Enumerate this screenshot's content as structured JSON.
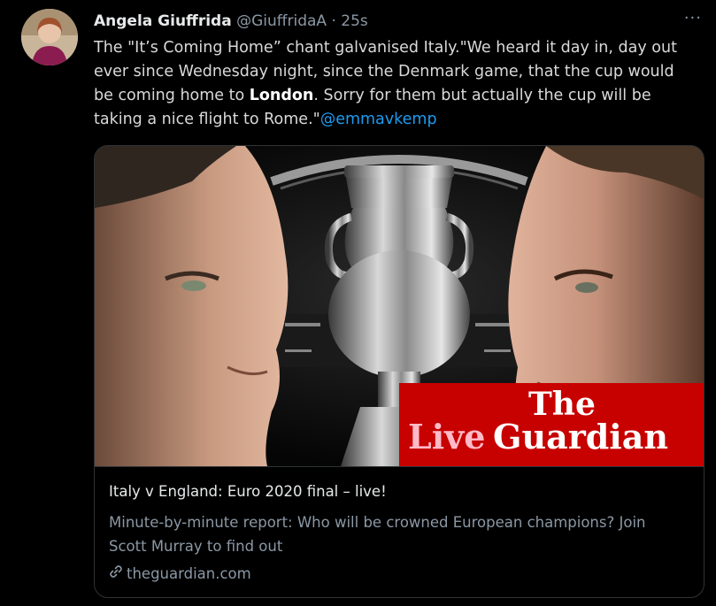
{
  "tweet": {
    "author_name": "Angela Giuffrida",
    "handle": "@GiuffridaA",
    "separator": "·",
    "time": "25s",
    "more_label": "···",
    "text_part1": "The \"It’s Coming Home” chant galvanised Italy.\"We heard it day in, day out ever since Wednesday night, since the Denmark game, that the cup would be coming home to ",
    "text_bold": "London",
    "text_part2": ". Sorry for them but actually the cup will be taking a nice flight to Rome.\"",
    "mention": "@emmavkemp"
  },
  "card": {
    "image_alt": "Italy v England Euro 2020 final graphic",
    "brand_the": "The",
    "brand_live": "Live",
    "brand_guardian": "Guardian",
    "title": "Italy v England: Euro 2020 final – live!",
    "description": "Minute-by-minute report: Who will be crowned European champions? Join Scott Murray to find out",
    "domain": "theguardian.com",
    "link_icon": "link-icon"
  },
  "colors": {
    "background": "#000000",
    "text": "#d9d9d9",
    "muted": "#8b98a5",
    "link": "#1d9bf0",
    "guardian_red": "#c70000",
    "guardian_pink": "#ffbac8"
  }
}
